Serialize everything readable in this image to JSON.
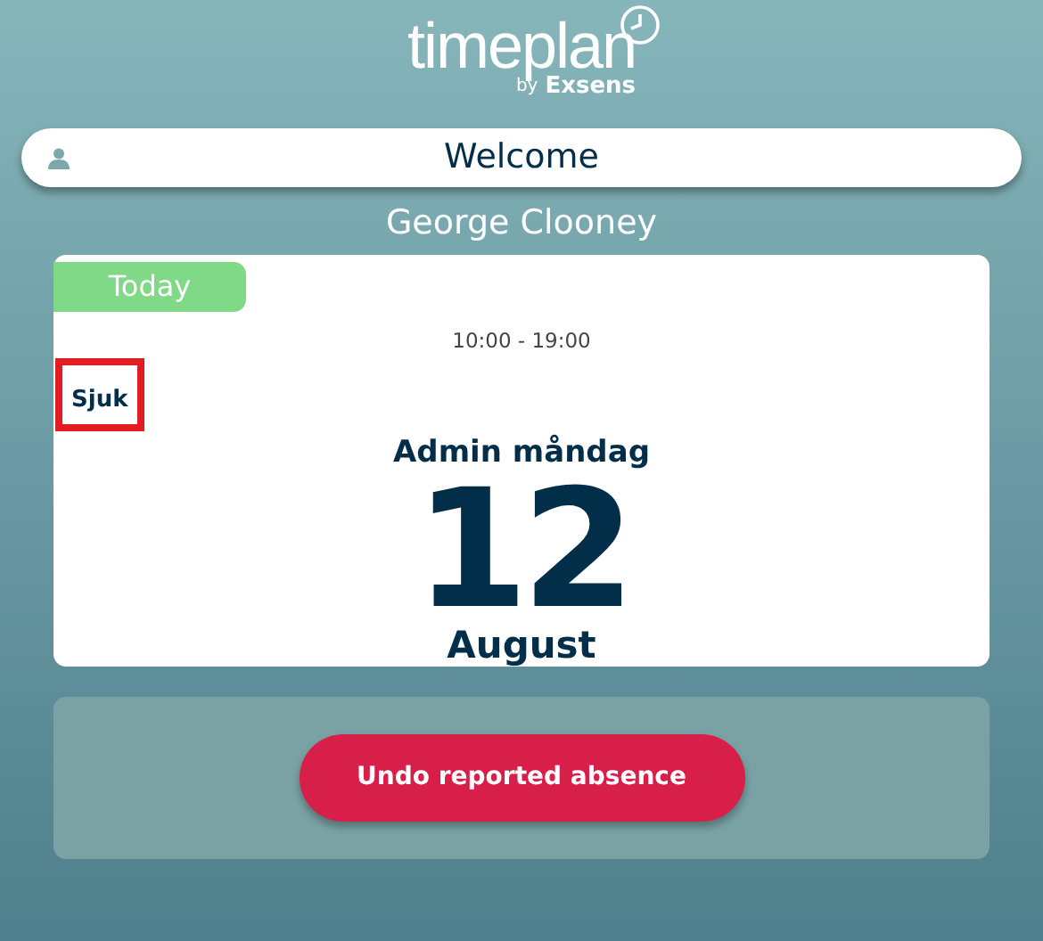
{
  "logo": {
    "name": "timeplan",
    "by": "by",
    "brand": "Exsens"
  },
  "welcome": {
    "text": "Welcome"
  },
  "user_name": "George Clooney",
  "day_card": {
    "today_badge": "Today",
    "time": "10:00 - 19:00",
    "absence": "Sjuk",
    "title": "Admin måndag",
    "day": "12",
    "month": "August"
  },
  "actions": [
    {
      "label": "Undo reported absence"
    }
  ]
}
